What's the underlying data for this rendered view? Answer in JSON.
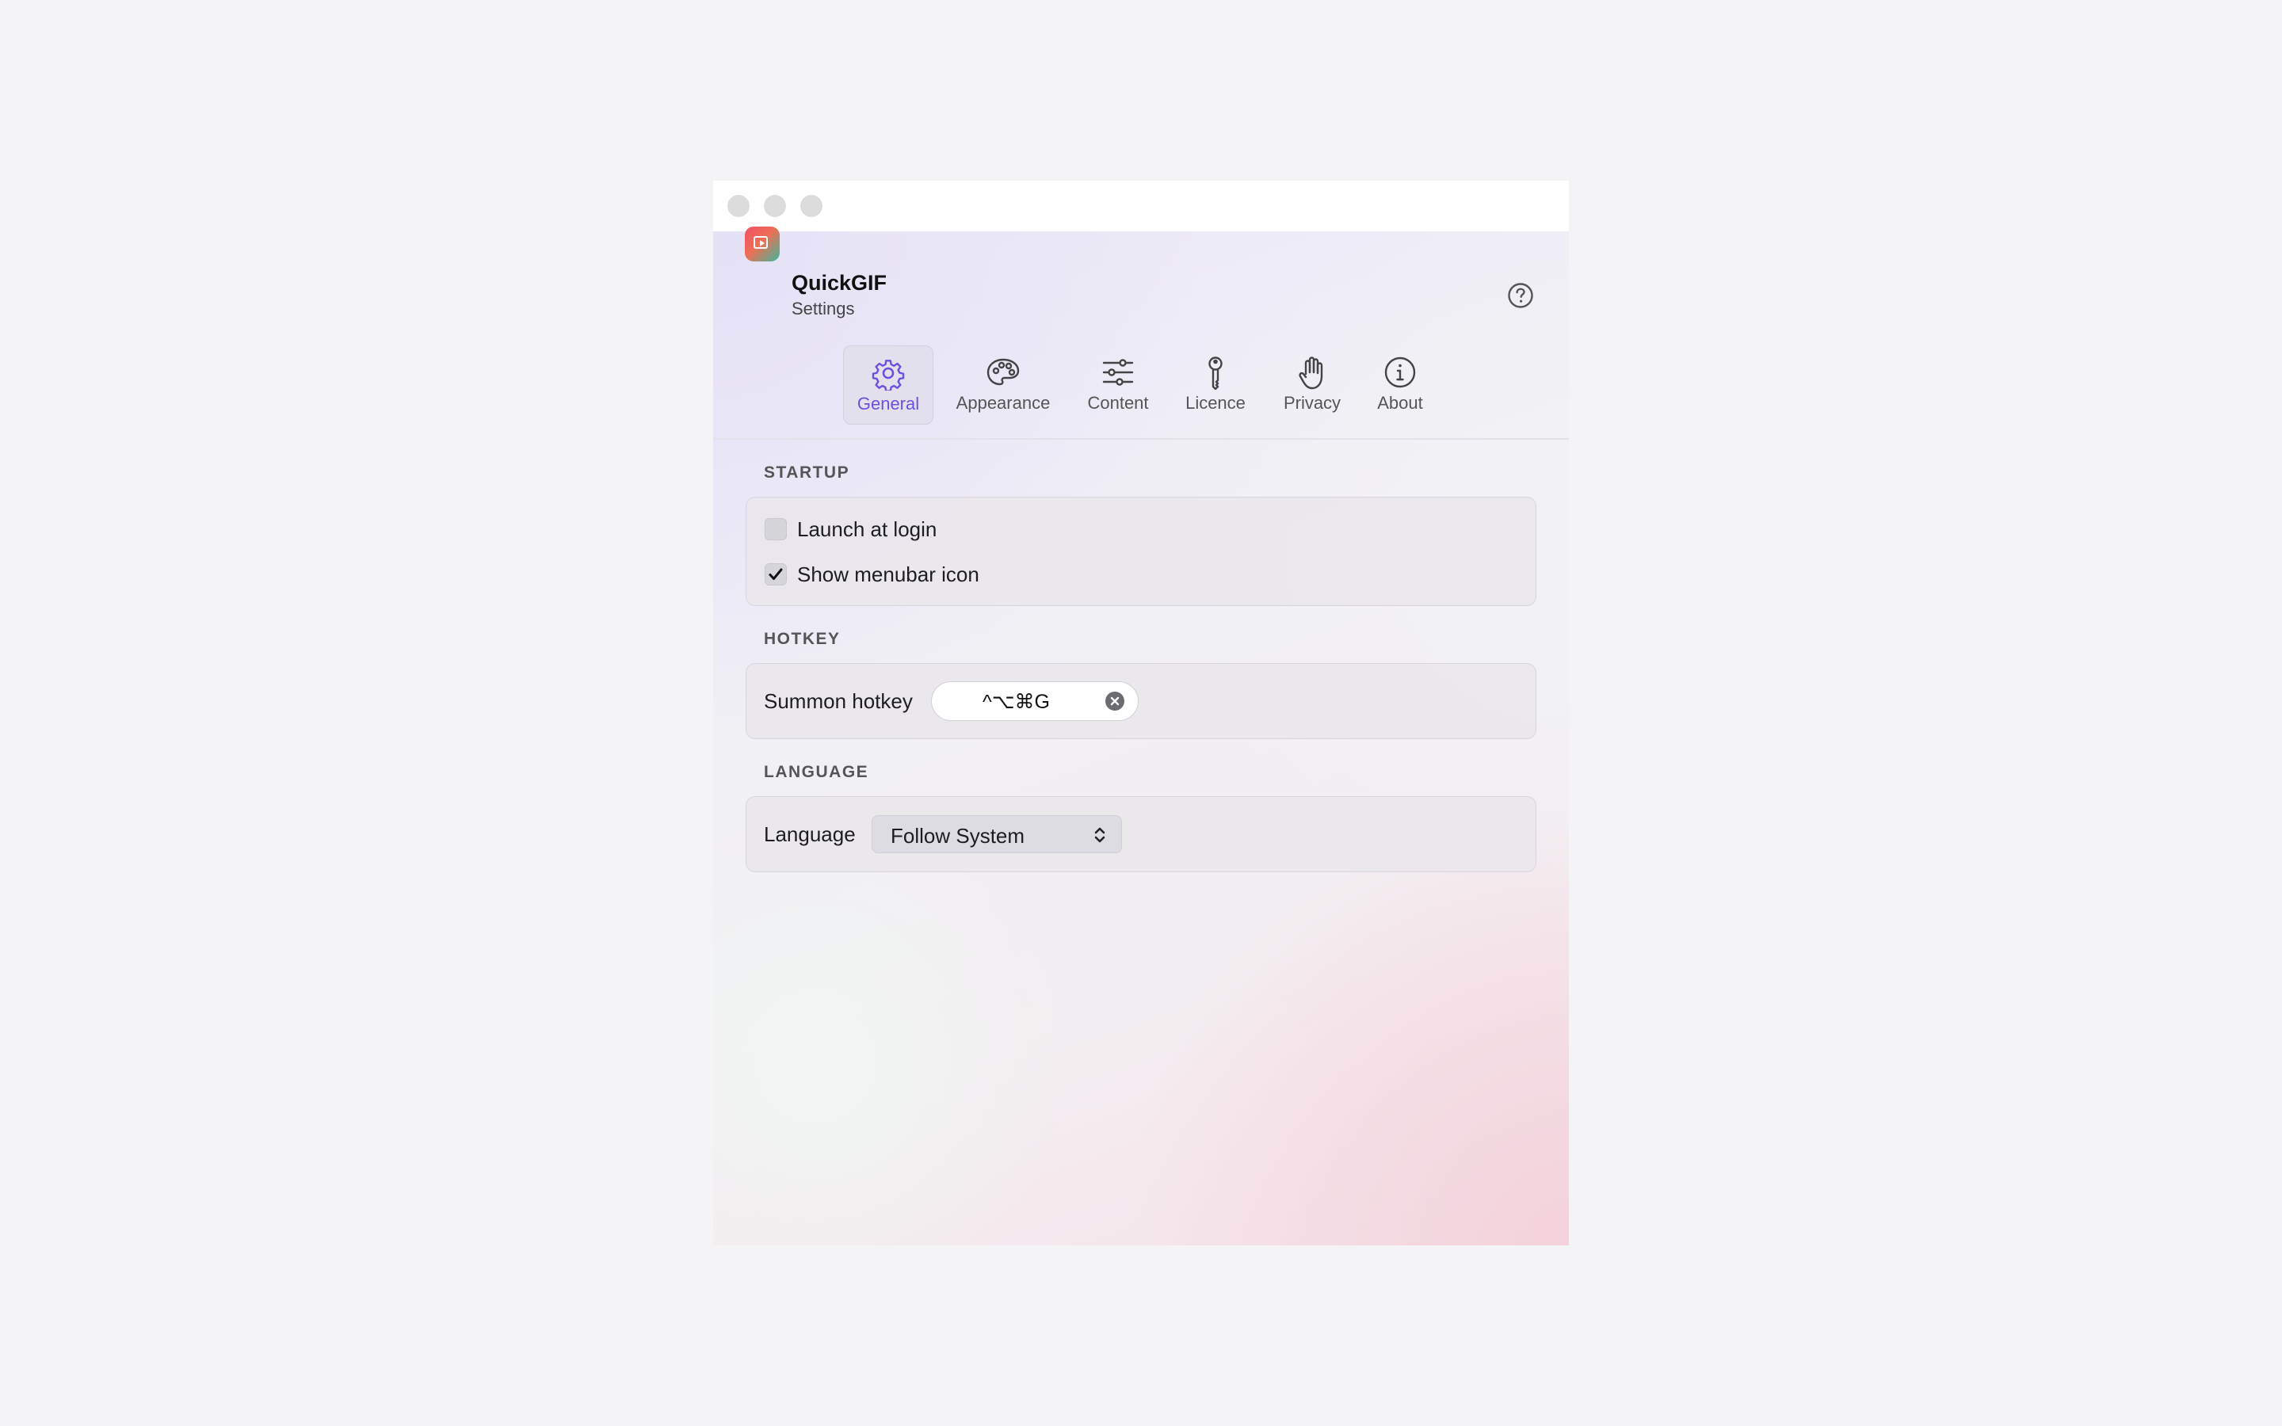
{
  "app": {
    "name": "QuickGIF",
    "subtitle": "Settings"
  },
  "tabs": [
    {
      "id": "general",
      "label": "General",
      "icon": "gear-icon",
      "active": true
    },
    {
      "id": "appearance",
      "label": "Appearance",
      "icon": "palette-icon",
      "active": false
    },
    {
      "id": "content",
      "label": "Content",
      "icon": "sliders-icon",
      "active": false
    },
    {
      "id": "licence",
      "label": "Licence",
      "icon": "key-icon",
      "active": false
    },
    {
      "id": "privacy",
      "label": "Privacy",
      "icon": "hand-icon",
      "active": false
    },
    {
      "id": "about",
      "label": "About",
      "icon": "info-icon",
      "active": false
    }
  ],
  "sections": {
    "startup": {
      "title": "STARTUP",
      "launch_at_login": {
        "label": "Launch at login",
        "checked": false
      },
      "show_menubar_icon": {
        "label": "Show menubar icon",
        "checked": true
      }
    },
    "hotkey": {
      "title": "HOTKEY",
      "summon_label": "Summon hotkey",
      "summon_value": "^⌥⌘G"
    },
    "language": {
      "title": "LANGUAGE",
      "label": "Language",
      "selected": "Follow System"
    }
  },
  "colors": {
    "accent": "#6d4fe0",
    "traffic_light": "#dcdcdc"
  }
}
